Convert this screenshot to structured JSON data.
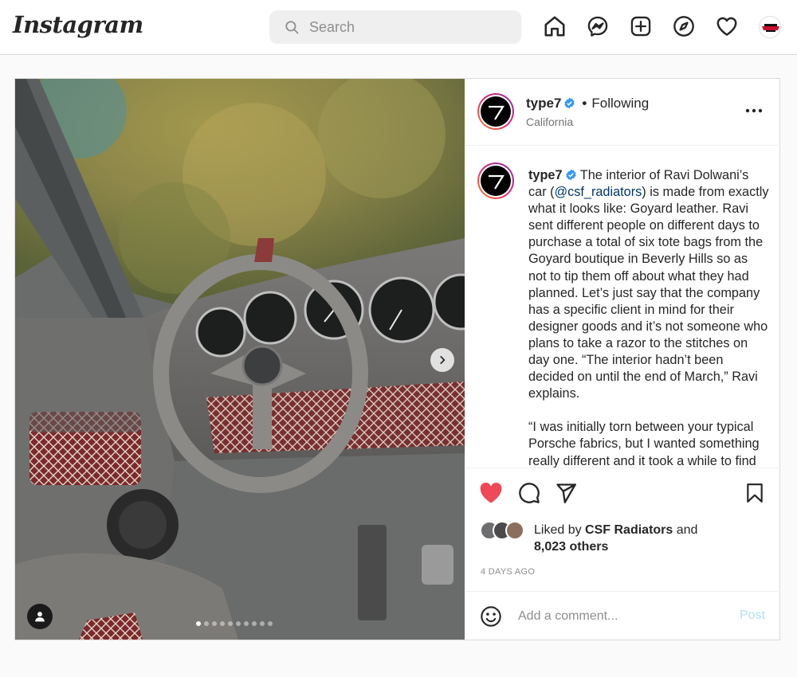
{
  "nav": {
    "logo": "Instagram",
    "search_placeholder": "Search",
    "icons": [
      "home-icon",
      "messenger-icon",
      "new-post-icon",
      "explore-icon",
      "activity-heart-icon"
    ]
  },
  "post": {
    "author": {
      "username": "type7",
      "verified": true,
      "follow_status": "Following",
      "location": "California"
    },
    "carousel": {
      "total_images": 10,
      "active_index": 0
    },
    "caption": {
      "username": "type7",
      "paragraph1_before": " The interior of Ravi Dolwani’s car (",
      "mention": "@csf_radiators",
      "paragraph1_after": ") is made from exactly what it looks like: Goyard leather. Ravi sent different people on different days to purchase a total of six tote bags from the Goyard boutique in Beverly Hills so as not to tip them off about what they had planned. Let’s just say that the company has a specific client in mind for their designer goods and it’s not someone who plans to take a razor to the stitches on day one. “The interior hadn’t been decided on until the end of March,” Ravi explains.",
      "paragraph2": "“I was initially torn between your typical Porsche fabrics, but I wanted something really different and it took a while to find"
    },
    "likes": {
      "prefix": "Liked by ",
      "by": "CSF Radiators",
      "middle": " and",
      "others": "8,023 others"
    },
    "time_ago": "4 DAYS AGO",
    "comment": {
      "placeholder": "Add a comment...",
      "post_label": "Post"
    },
    "colors": {
      "liked_heart": "#ed4956",
      "verified": "#3897f0",
      "mention": "#00376b",
      "post_disabled": "#b2dffc"
    }
  }
}
